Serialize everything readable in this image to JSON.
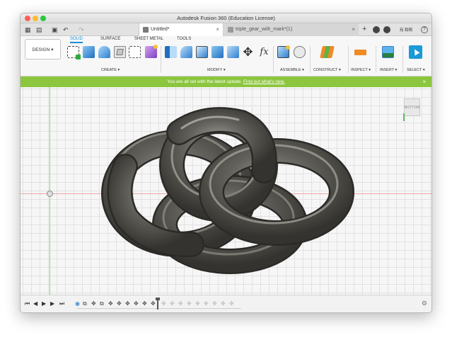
{
  "window": {
    "title": "Autodesk Fusion 360 (Education License)",
    "traffic_colors": [
      "#fe5f57",
      "#febc2e",
      "#28c840"
    ]
  },
  "tabbar": {
    "grid_icon": "▦",
    "file_icon": "▤",
    "save_icon": "▣",
    "undo_icon": "↶",
    "redo_icon": "↷",
    "tabs": [
      {
        "label": "Untitled*",
        "close": "×"
      },
      {
        "label": "triple_gear_with_mark*(1)",
        "close": "×"
      }
    ],
    "add_tab": "+",
    "user_label": "宛 和翔",
    "help": "?"
  },
  "ribbon": {
    "design_label": "DESIGN ▾",
    "workspace_tabs": [
      "SOLID",
      "SURFACE",
      "SHEET METAL",
      "TOOLS"
    ],
    "groups": {
      "create": "CREATE ▾",
      "modify": "MODIFY ▾",
      "assemble": "ASSEMBLE ▾",
      "construct": "CONSTRUCT ▾",
      "inspect": "INSPECT ▾",
      "insert": "INSERT ▾",
      "select": "SELECT ▾"
    },
    "fx_label": "fx",
    "move_glyph": "✥"
  },
  "banner": {
    "text": "You are all set with the latest update.",
    "link": "Find out what's new.",
    "close": "×",
    "color": "#8cc63f"
  },
  "viewport": {
    "viewcube_label": "BOTTOM",
    "model_color": "#5e5c56"
  },
  "timeline": {
    "controls": [
      "⏮",
      "◀",
      "▶",
      "▶",
      "⏭"
    ],
    "settings": "⚙"
  }
}
